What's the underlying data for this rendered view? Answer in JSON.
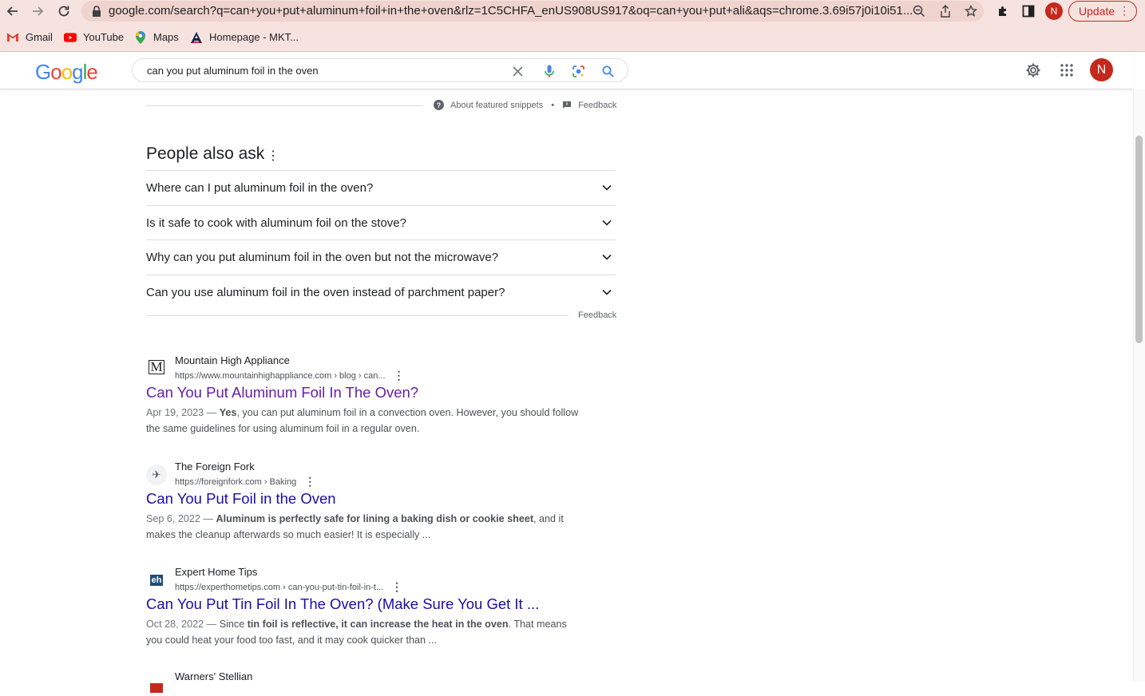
{
  "browser": {
    "url": "google.com/search?q=can+you+put+aluminum+foil+in+the+oven&rlz=1C5CHFA_enUS908US917&oq=can+you+put+ali&aqs=chrome.3.69i57j0i10i51...",
    "profile_initial": "N",
    "update_label": "Update",
    "update_menu": "⋮"
  },
  "bookmarks": [
    {
      "label": "Gmail"
    },
    {
      "label": "YouTube"
    },
    {
      "label": "Maps"
    },
    {
      "label": "Homepage - MKT..."
    }
  ],
  "google": {
    "query": "can you put aluminum foil in the oven",
    "avatar_initial": "N",
    "clear_glyph": "✕"
  },
  "snippets": {
    "about": "About featured snippets",
    "separator": "•",
    "feedback": "Feedback"
  },
  "paa": {
    "title": "People also ask",
    "menu": "⋮",
    "questions": [
      "Where can I put aluminum foil in the oven?",
      "Is it safe to cook with aluminum foil on the stove?",
      "Why can you put aluminum foil in the oven but not the microwave?",
      "Can you use aluminum foil in the oven instead of parchment paper?"
    ],
    "feedback": "Feedback"
  },
  "results": [
    {
      "site": "Mountain High Appliance",
      "cite": "https://www.mountainhighappliance.com › blog › can...",
      "title": "Can You Put Aluminum Foil In The Oven?",
      "title_color": "#681da8",
      "date": "Apr 19, 2023 — ",
      "bold1": "Yes",
      "rest1": ", you can put aluminum foil in a convection oven. However, you should follow the same guidelines for using aluminum foil in a regular oven.",
      "favicon_glyph": "M"
    },
    {
      "site": "The Foreign Fork",
      "cite": "https://foreignfork.com › Baking",
      "title": "Can You Put Foil in the Oven",
      "title_color": "#1a0dab",
      "date": "Sep 6, 2022 — ",
      "bold1": "Aluminum is perfectly safe for lining a baking dish or cookie sheet",
      "rest1": ", and it makes the cleanup afterwards so much easier! It is especially ...",
      "favicon_glyph": "✈"
    },
    {
      "site": "Expert Home Tips",
      "cite": "https://experthometips.com › can-you-put-tin-foil-in-t...",
      "title": "Can You Put Tin Foil In The Oven? (Make Sure You Get It ...",
      "title_color": "#1a0dab",
      "date": "Oct 28, 2022 — ",
      "pre": "Since ",
      "bold1": "tin foil is reflective, it can increase the heat in the oven",
      "rest1": ". That means you could heat your food too fast, and it may cook quicker than ...",
      "favicon_glyph": "eh"
    },
    {
      "site": "Warners' Stellian"
    }
  ],
  "result_menu": "⋮",
  "colors": {
    "chrome_bg": "#f6e3df",
    "omnibox_bg": "#efd3cd",
    "accent_red": "#c5281c",
    "link_blue": "#1a0dab",
    "link_visited": "#681da8"
  }
}
